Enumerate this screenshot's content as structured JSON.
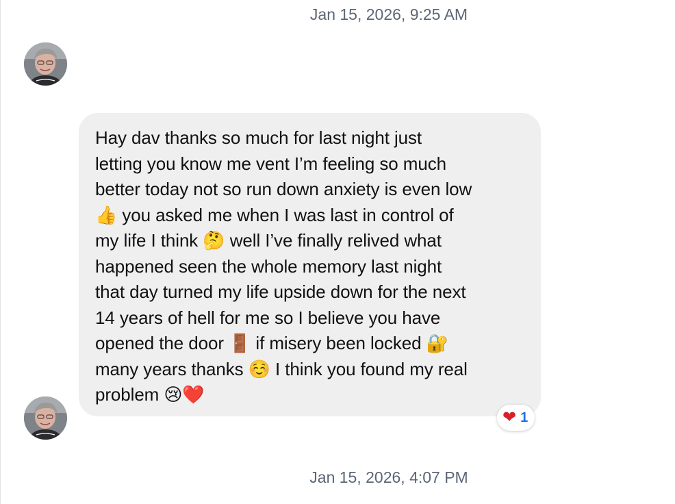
{
  "thread": {
    "timestamp_top": "Jan 15, 2026, 9:25 AM",
    "timestamp_bottom": "Jan 15, 2026, 4:07 PM"
  },
  "message": {
    "sender": "contact",
    "text": "Hay dav thanks so much for last night just\nletting you know me vent I’m feeling so much\nbetter today not so run down anxiety is even low\n👍  you asked me when I was last in control of\nmy life I think 🤔 well I’ve finally relived  what\nhappened seen the whole memory last night\nthat day turned my life upside down  for the next\n14 years of hell for me  so I believe you have\nopened the door 🚪 if misery been locked 🔐\nmany years  thanks ☺️ I think you found my real\nproblem 😢❤️"
  },
  "reaction": {
    "emoji": "❤",
    "count": "1"
  },
  "colors": {
    "bubble_background": "#efefef",
    "timestamp_text": "#5b6675",
    "reaction_count": "#1f6fe5",
    "heart": "#d9202a"
  },
  "icons": {
    "avatar": "contact-avatar-photo"
  }
}
